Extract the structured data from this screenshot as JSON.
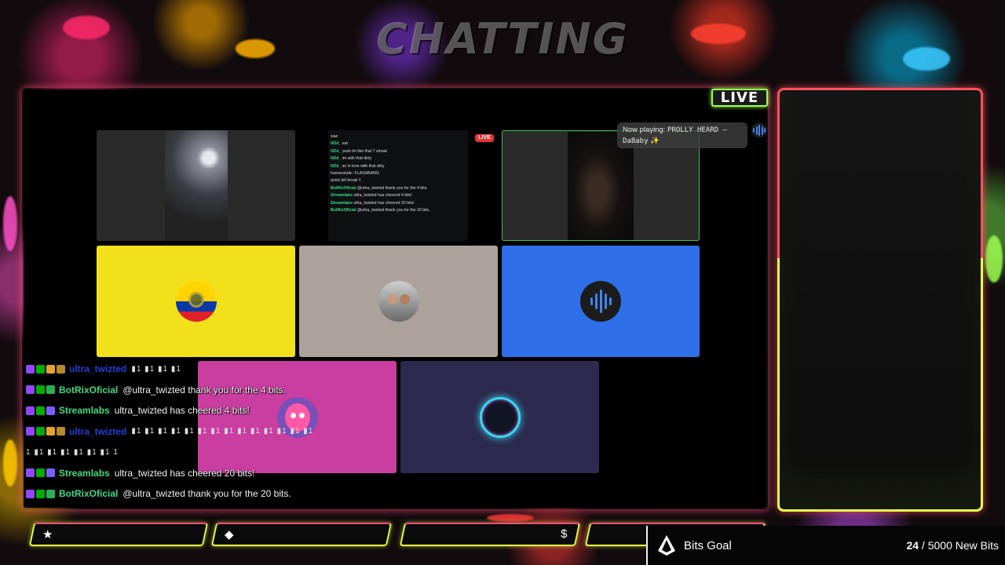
{
  "scene": {
    "title": "CHATTING",
    "live_badge": "LIVE"
  },
  "now_playing": {
    "label": "Now playing:",
    "track": "PROLLY HEARD – DaBaby",
    "sparkle": "✨"
  },
  "mini_stream": {
    "live_label": "LIVE",
    "lines": [
      {
        "user": "",
        "text": "saw"
      },
      {
        "user": "lil2d_",
        "text": "eat"
      },
      {
        "user": "lil2d_",
        "text": "yeah im like that 7 streak"
      },
      {
        "user": "lil2d_",
        "text": "im with that dirty"
      },
      {
        "user": "lil2d_",
        "text": "so in love with that dirty"
      },
      {
        "user": "",
        "text": "humaxstatic: FLASHBANG"
      },
      {
        "user": "",
        "text": "quick kitl break !!"
      },
      {
        "user": "BotRixOficial",
        "text": "@ultra_twizted thank you for the 4 bits."
      },
      {
        "user": "Streamlabs",
        "text": "ultra_twizted has cheered 4 bits!"
      },
      {
        "user": "Streamlabs",
        "text": "ultra_twizted has cheered 20 bits!"
      },
      {
        "user": "BotRixOficial",
        "text": "@ultra_twizted thank you for the 20 bits."
      }
    ]
  },
  "chat": [
    {
      "user": "ultra_twizted",
      "user_color": "#1f3fd6",
      "badges": [
        "b-tw",
        "b-mod",
        "b-gift",
        "b-sub"
      ],
      "message": "",
      "emotes": "▮1 ▮1 ▮1 ▮1"
    },
    {
      "user": "BotRixOficial",
      "user_color": "#3ddc84",
      "badges": [
        "b-tw",
        "b-mod",
        "b-bot"
      ],
      "message": "@ultra_twizted thank you for the 4 bits.",
      "emotes": ""
    },
    {
      "user": "Streamlabs",
      "user_color": "#3ddc84",
      "badges": [
        "b-tw",
        "b-mod",
        "b-vip"
      ],
      "message": "ultra_twizted has cheered 4 bits!",
      "emotes": ""
    },
    {
      "user": "ultra_twizted",
      "user_color": "#1f3fd6",
      "badges": [
        "b-tw",
        "b-mod",
        "b-gift",
        "b-sub"
      ],
      "message": "",
      "emotes": "▮1 ▮1 ▮1 ▮1 ▮1 ▮1 ▮1 ▮1 ▮1 ▮1 ▮1 ▮1 ▮1 ▮1"
    },
    {
      "user": "",
      "user_color": "#ffffff",
      "badges": [],
      "message": "",
      "emotes": "1 ▮1 ▮1 ▮1 ▮1 ▮1 ▮1 1"
    },
    {
      "user": "Streamlabs",
      "user_color": "#3ddc84",
      "badges": [
        "b-tw",
        "b-mod",
        "b-vip"
      ],
      "message": "ultra_twizted has cheered 20 bits!",
      "emotes": ""
    },
    {
      "user": "BotRixOficial",
      "user_color": "#3ddc84",
      "badges": [
        "b-tw",
        "b-mod",
        "b-bot"
      ],
      "message": "@ultra_twizted thank you for the 20 bits.",
      "emotes": ""
    }
  ],
  "bottom_bar": {
    "icons": [
      "★",
      "◆",
      "",
      "$"
    ]
  },
  "bits_goal": {
    "label": "Bits Goal",
    "current": "24",
    "separator": " / ",
    "target": "5000 New Bits"
  },
  "colors": {
    "accent_green": "#9cff50",
    "frame_red": "#ff5060",
    "frame_yellow": "#e6ff4a"
  },
  "icons": {
    "goal": "triangle-logo-icon",
    "music": "audio-wave-icon"
  }
}
